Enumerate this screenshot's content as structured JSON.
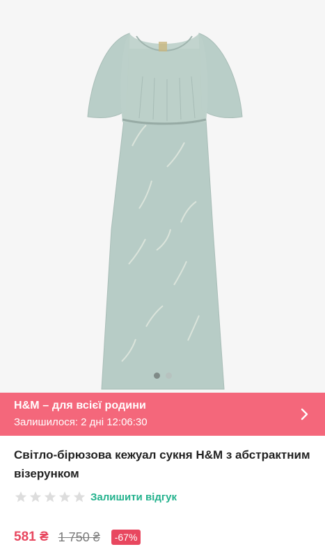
{
  "product": {
    "title": "Світло-бірюзова кежуал сукня H&M з абстрактним візерунком",
    "image_icon": "dress-product-photo",
    "dress_color": "#b7ccc6",
    "carousel": {
      "count": 2,
      "active_index": 0
    }
  },
  "promo": {
    "title": "H&M – для всієї родини",
    "timer": "Залишилося: 2 дні 12:06:30",
    "color": "#f4677b"
  },
  "rating": {
    "stars_filled": 0,
    "stars_total": 5,
    "review_link": "Залишити відгук"
  },
  "price": {
    "current": "581 ₴",
    "old": "1 750 ₴",
    "discount": "-67%"
  },
  "colors": {
    "accent": "#e8475f",
    "review_link": "#23b28d"
  }
}
